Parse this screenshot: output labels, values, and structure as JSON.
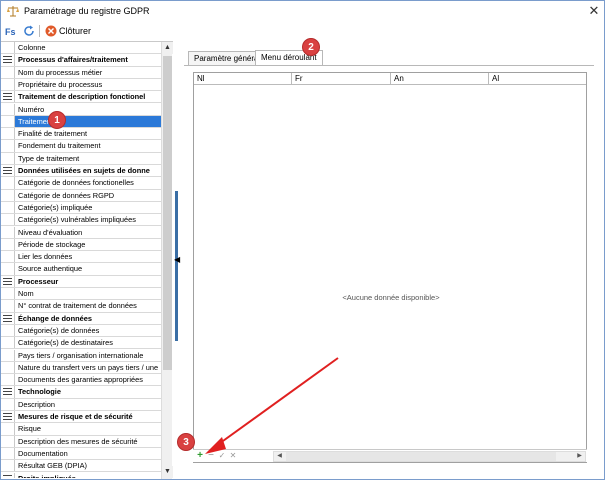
{
  "window": {
    "title": "Paramétrage du registre GDPR",
    "close_glyph": "✕"
  },
  "toolbar": {
    "close_label": "Clôturer"
  },
  "colors": {
    "selection": "#2b79d8",
    "annotation_red": "#d94141",
    "add_green": "#2e9b2e"
  },
  "left_grid": {
    "header": "Colonne",
    "rows": [
      {
        "label": "Processus d'affaires/traitement",
        "group": true
      },
      {
        "label": "Nom du processus métier",
        "group": false
      },
      {
        "label": "Propriétaire du processus",
        "group": false
      },
      {
        "label": "Traitement de description fonctionel",
        "group": true
      },
      {
        "label": "Numéro",
        "group": false
      },
      {
        "label": "Traitement",
        "group": false,
        "selected": true
      },
      {
        "label": "Finalité de traitement",
        "group": false
      },
      {
        "label": "Fondement du traitement",
        "group": false
      },
      {
        "label": "Type de traitement",
        "group": false
      },
      {
        "label": "Données utilisées en sujets de donne",
        "group": true
      },
      {
        "label": "Catégorie de données fonctionelles",
        "group": false
      },
      {
        "label": "Catégorie de données RGPD",
        "group": false
      },
      {
        "label": "Catégorie(s) impliquée",
        "group": false
      },
      {
        "label": "Catégorie(s) vulnérables impliquées",
        "group": false
      },
      {
        "label": "Niveau d'évaluation",
        "group": false
      },
      {
        "label": "Période de stockage",
        "group": false
      },
      {
        "label": "Lier les données",
        "group": false
      },
      {
        "label": "Source authentique",
        "group": false
      },
      {
        "label": "Processeur",
        "group": true
      },
      {
        "label": "Nom",
        "group": false
      },
      {
        "label": "N° contrat de traitement de données",
        "group": false
      },
      {
        "label": "Échange de données",
        "group": true
      },
      {
        "label": "Catégorie(s) de données",
        "group": false
      },
      {
        "label": "Catégorie(s) de destinataires",
        "group": false
      },
      {
        "label": "Pays tiers / organisation internationale",
        "group": false
      },
      {
        "label": "Nature du transfert vers un pays tiers / une",
        "group": false
      },
      {
        "label": "Documents des garanties appropriées",
        "group": false
      },
      {
        "label": "Technologie",
        "group": true
      },
      {
        "label": "Description",
        "group": false
      },
      {
        "label": "Mesures de risque et de sécurité",
        "group": true
      },
      {
        "label": "Risque",
        "group": false
      },
      {
        "label": "Description des mesures de sécurité",
        "group": false
      },
      {
        "label": "Documentation",
        "group": false
      },
      {
        "label": "Résultat GEB (DPIA)",
        "group": false
      },
      {
        "label": "Droits impliqués",
        "group": true
      }
    ]
  },
  "tabs": [
    {
      "label": "Paramètre général",
      "active": false
    },
    {
      "label": "Menu déroulant",
      "active": true
    }
  ],
  "table": {
    "columns": [
      "Nl",
      "Fr",
      "An",
      "Al"
    ],
    "empty_message": "<Aucune donnée disponible>"
  },
  "bottom_nav": {
    "add": "+",
    "remove": "−",
    "confirm": "✓",
    "cancel": "✕"
  },
  "annotations": [
    "1",
    "2",
    "3"
  ]
}
